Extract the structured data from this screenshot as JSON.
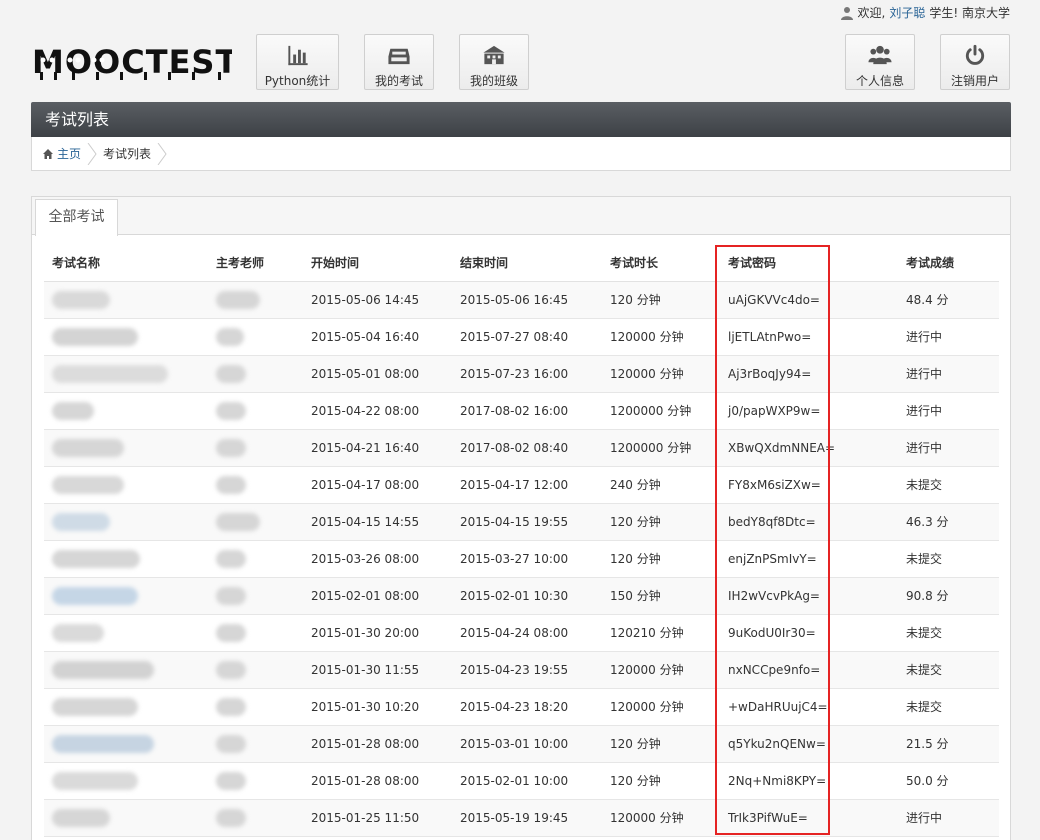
{
  "user": {
    "welcome": "欢迎,",
    "name": "刘子聪",
    "suffix": "学生! 南京大学"
  },
  "logo": {
    "text": "MOOCTEST"
  },
  "nav": {
    "python": "Python统计",
    "my_exam": "我的考试",
    "my_class": "我的班级",
    "profile": "个人信息",
    "logout": "注销用户"
  },
  "page_title": "考试列表",
  "breadcrumb": {
    "home": "主页",
    "current": "考试列表"
  },
  "tab": "全部考试",
  "table": {
    "headers": [
      "考试名称",
      "主考老师",
      "开始时间",
      "结束时间",
      "考试时长",
      "考试密码",
      "考试成绩"
    ],
    "rows": [
      {
        "start": "2015-05-06 14:45",
        "end": "2015-05-06 16:45",
        "duration": "120 分钟",
        "password": "uAjGKVVc4do=",
        "score": "48.4 分",
        "status": "ok"
      },
      {
        "start": "2015-05-04 16:40",
        "end": "2015-07-27 08:40",
        "duration": "120000 分钟",
        "password": "ljETLAtnPwo=",
        "score": "进行中",
        "status": "ok"
      },
      {
        "start": "2015-05-01 08:00",
        "end": "2015-07-23 16:00",
        "duration": "120000 分钟",
        "password": "Aj3rBoqJy94=",
        "score": "进行中",
        "status": "ok"
      },
      {
        "start": "2015-04-22 08:00",
        "end": "2017-08-02 16:00",
        "duration": "1200000 分钟",
        "password": "j0/papWXP9w=",
        "score": "进行中",
        "status": "ok"
      },
      {
        "start": "2015-04-21 16:40",
        "end": "2017-08-02 08:40",
        "duration": "1200000 分钟",
        "password": "XBwQXdmNNEA=",
        "score": "进行中",
        "status": "ok"
      },
      {
        "start": "2015-04-17 08:00",
        "end": "2015-04-17 12:00",
        "duration": "240 分钟",
        "password": "FY8xM6siZXw=",
        "score": "未提交",
        "status": "bad"
      },
      {
        "start": "2015-04-15 14:55",
        "end": "2015-04-15 19:55",
        "duration": "120 分钟",
        "password": "bedY8qf8Dtc=",
        "score": "46.3 分",
        "status": "ok"
      },
      {
        "start": "2015-03-26 08:00",
        "end": "2015-03-27 10:00",
        "duration": "120 分钟",
        "password": "enjZnPSmIvY=",
        "score": "未提交",
        "status": "bad"
      },
      {
        "start": "2015-02-01 08:00",
        "end": "2015-02-01 10:30",
        "duration": "150 分钟",
        "password": "IH2wVcvPkAg=",
        "score": "90.8 分",
        "status": "ok"
      },
      {
        "start": "2015-01-30 20:00",
        "end": "2015-04-24 08:00",
        "duration": "120210 分钟",
        "password": "9uKodU0Ir30=",
        "score": "未提交",
        "status": "bad"
      },
      {
        "start": "2015-01-30 11:55",
        "end": "2015-04-23 19:55",
        "duration": "120000 分钟",
        "password": "nxNCCpe9nfo=",
        "score": "未提交",
        "status": "bad"
      },
      {
        "start": "2015-01-30 10:20",
        "end": "2015-04-23 18:20",
        "duration": "120000 分钟",
        "password": "+wDaHRUujC4=",
        "score": "未提交",
        "status": "bad"
      },
      {
        "start": "2015-01-28 08:00",
        "end": "2015-03-01 10:00",
        "duration": "120 分钟",
        "password": "q5Yku2nQENw=",
        "score": "21.5 分",
        "status": "ok"
      },
      {
        "start": "2015-01-28 08:00",
        "end": "2015-02-01 10:00",
        "duration": "120 分钟",
        "password": "2Nq+Nmi8KPY=",
        "score": "50.0 分",
        "status": "ok"
      },
      {
        "start": "2015-01-25 11:50",
        "end": "2015-05-19 19:45",
        "duration": "120000 分钟",
        "password": "TrIk3PifWuE=",
        "score": "进行中",
        "status": "ok"
      }
    ]
  },
  "colors": {
    "title_bar": "#4a4e53",
    "score_ok": "#3c8a3c",
    "score_bad": "#b03030",
    "highlight": "#e52323",
    "link": "#2a6496"
  }
}
